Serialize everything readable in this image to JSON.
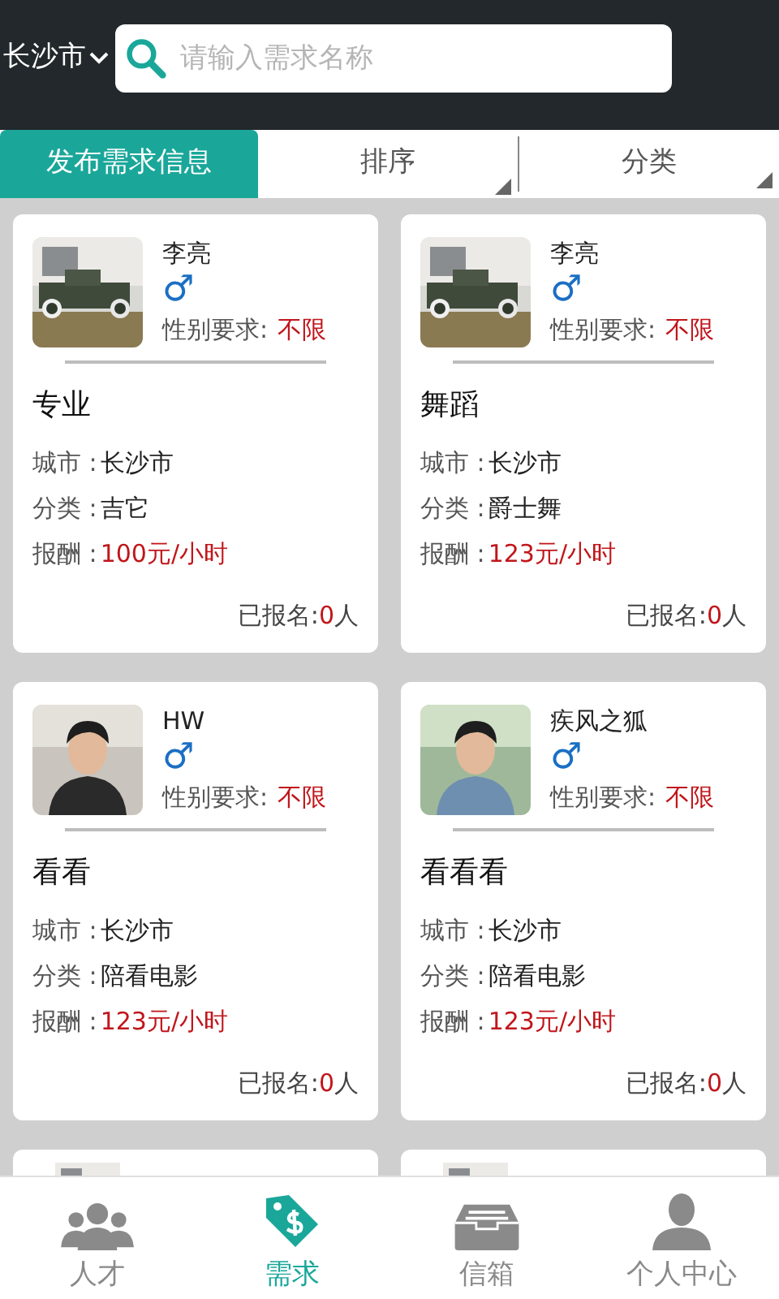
{
  "header": {
    "city": "长沙市",
    "search": {
      "placeholder": "请输入需求名称"
    }
  },
  "toolbar": {
    "publish": "发布需求信息",
    "filters": [
      "排序",
      "分类"
    ]
  },
  "cards": [
    {
      "kind": "full",
      "name": "李亮",
      "gender": "♂",
      "gender_req_label": "性别要求:",
      "gender_req": "不限",
      "title": "专业",
      "rows": [
        {
          "label": "城市 :",
          "value": "长沙市",
          "kind": "plain"
        },
        {
          "label": "分类 :",
          "value": "吉它",
          "kind": "plain"
        },
        {
          "label": "报酬 :",
          "value": "100元/小时",
          "kind": "price"
        }
      ],
      "signup_label": "已报名:",
      "signup_count": "0",
      "signup_unit": "人"
    },
    {
      "kind": "full",
      "name": "李亮",
      "gender": "♂",
      "gender_req_label": "性别要求:",
      "gender_req": "不限",
      "title": "舞蹈",
      "rows": [
        {
          "label": "城市 :",
          "value": "长沙市",
          "kind": "plain"
        },
        {
          "label": "分类 :",
          "value": "爵士舞",
          "kind": "plain"
        },
        {
          "label": "报酬 :",
          "value": "123元/小时",
          "kind": "price"
        }
      ],
      "signup_label": "已报名:",
      "signup_count": "0",
      "signup_unit": "人"
    },
    {
      "kind": "full",
      "name": "HW",
      "gender": "♂",
      "gender_req_label": "性别要求:",
      "gender_req": "不限",
      "title": "看看",
      "rows": [
        {
          "label": "城市 :",
          "value": "长沙市",
          "kind": "plain"
        },
        {
          "label": "分类 :",
          "value": "陪看电影",
          "kind": "plain"
        },
        {
          "label": "报酬 :",
          "value": "123元/小时",
          "kind": "price"
        }
      ],
      "signup_label": "已报名:",
      "signup_count": "0",
      "signup_unit": "人"
    },
    {
      "kind": "full",
      "name": "疾风之狐",
      "gender": "♂",
      "gender_req_label": "性别要求:",
      "gender_req": "不限",
      "title": "看看看",
      "rows": [
        {
          "label": "城市 :",
          "value": "长沙市",
          "kind": "plain"
        },
        {
          "label": "分类 :",
          "value": "陪看电影",
          "kind": "plain"
        },
        {
          "label": "报酬 :",
          "value": "123元/小时",
          "kind": "price"
        }
      ],
      "signup_label": "已报名:",
      "signup_count": "0",
      "signup_unit": "人"
    },
    {
      "kind": "partial"
    },
    {
      "kind": "partial"
    }
  ],
  "nav": [
    {
      "label": "人才",
      "selected": false
    },
    {
      "label": "需求",
      "selected": true
    },
    {
      "label": "信箱",
      "selected": false
    },
    {
      "label": "个人中心",
      "selected": false
    }
  ]
}
